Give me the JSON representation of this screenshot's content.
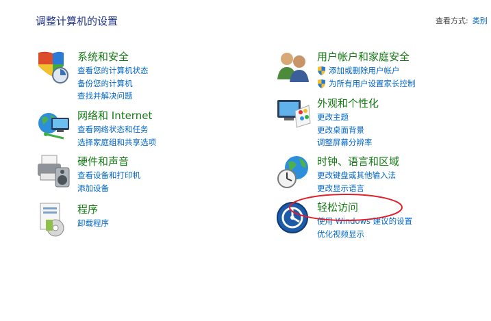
{
  "header": {
    "title": "调整计算机的设置",
    "view_by_label": "查看方式:",
    "view_by_value": "类别"
  },
  "categories": [
    {
      "title": "系统和安全",
      "icon": "shield-icon",
      "links": [
        "查看您的计算机状态",
        "备份您的计算机",
        "查找并解决问题"
      ]
    },
    {
      "title": "网络和 Internet",
      "icon": "network-globe-icon",
      "links": [
        "查看网络状态和任务",
        "选择家庭组和共享选项"
      ]
    },
    {
      "title": "硬件和声音",
      "icon": "printer-speaker-icon",
      "links": [
        "查看设备和打印机",
        "添加设备"
      ]
    },
    {
      "title": "程序",
      "icon": "programs-icon",
      "links": [
        "卸载程序"
      ]
    },
    {
      "title": "用户帐户和家庭安全",
      "icon": "users-icon",
      "links": [
        "添加或删除用户帐户",
        "为所有用户设置家长控制"
      ]
    },
    {
      "title": "外观和个性化",
      "icon": "monitor-palette-icon",
      "links": [
        "更改主题",
        "更改桌面背景",
        "调整屏幕分辨率"
      ]
    },
    {
      "title": "时钟、语言和区域",
      "icon": "clock-globe-icon",
      "links": [
        "更改键盘或其他输入法",
        "更改显示语言"
      ]
    },
    {
      "title": "轻松访问",
      "icon": "ease-of-access-icon",
      "links": [
        "使用 Windows 建议的设置",
        "优化视频显示"
      ]
    }
  ],
  "colors": {
    "title": "#1e3287",
    "category": "#147a14",
    "link": "#0066cc",
    "annotation": "#e0202a"
  }
}
